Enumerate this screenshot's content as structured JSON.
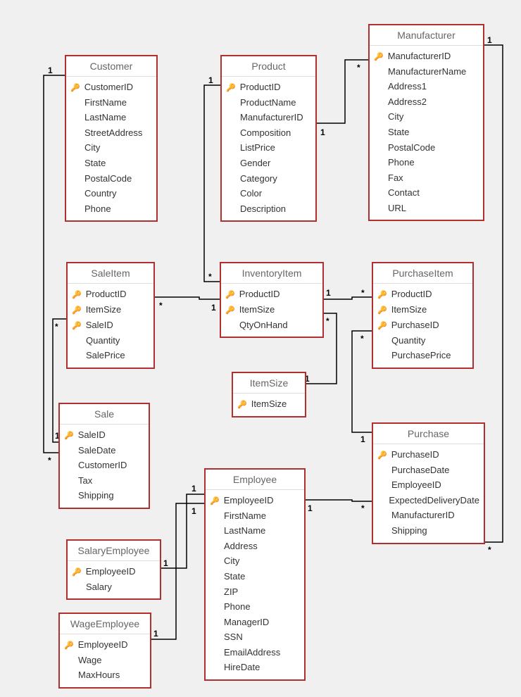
{
  "entities": {
    "customer": {
      "title": "Customer",
      "fields": [
        {
          "name": "CustomerID",
          "pk": true
        },
        {
          "name": "FirstName",
          "pk": false
        },
        {
          "name": "LastName",
          "pk": false
        },
        {
          "name": "StreetAddress",
          "pk": false
        },
        {
          "name": "City",
          "pk": false
        },
        {
          "name": "State",
          "pk": false
        },
        {
          "name": "PostalCode",
          "pk": false
        },
        {
          "name": "Country",
          "pk": false
        },
        {
          "name": "Phone",
          "pk": false
        }
      ]
    },
    "product": {
      "title": "Product",
      "fields": [
        {
          "name": "ProductID",
          "pk": true
        },
        {
          "name": "ProductName",
          "pk": false
        },
        {
          "name": "ManufacturerID",
          "pk": false
        },
        {
          "name": "Composition",
          "pk": false
        },
        {
          "name": "ListPrice",
          "pk": false
        },
        {
          "name": "Gender",
          "pk": false
        },
        {
          "name": "Category",
          "pk": false
        },
        {
          "name": "Color",
          "pk": false
        },
        {
          "name": "Description",
          "pk": false
        }
      ]
    },
    "manufacturer": {
      "title": "Manufacturer",
      "fields": [
        {
          "name": "ManufacturerID",
          "pk": true
        },
        {
          "name": "ManufacturerName",
          "pk": false
        },
        {
          "name": "Address1",
          "pk": false
        },
        {
          "name": "Address2",
          "pk": false
        },
        {
          "name": "City",
          "pk": false
        },
        {
          "name": "State",
          "pk": false
        },
        {
          "name": "PostalCode",
          "pk": false
        },
        {
          "name": "Phone",
          "pk": false
        },
        {
          "name": "Fax",
          "pk": false
        },
        {
          "name": "Contact",
          "pk": false
        },
        {
          "name": "URL",
          "pk": false
        }
      ]
    },
    "saleitem": {
      "title": "SaleItem",
      "fields": [
        {
          "name": "ProductID",
          "pk": true
        },
        {
          "name": "ItemSize",
          "pk": true
        },
        {
          "name": "SaleID",
          "pk": true
        },
        {
          "name": "Quantity",
          "pk": false
        },
        {
          "name": "SalePrice",
          "pk": false
        }
      ]
    },
    "inventoryitem": {
      "title": "InventoryItem",
      "fields": [
        {
          "name": "ProductID",
          "pk": true
        },
        {
          "name": "ItemSize",
          "pk": true
        },
        {
          "name": "QtyOnHand",
          "pk": false
        }
      ]
    },
    "purchaseitem": {
      "title": "PurchaseItem",
      "fields": [
        {
          "name": "ProductID",
          "pk": true
        },
        {
          "name": "ItemSize",
          "pk": true
        },
        {
          "name": "PurchaseID",
          "pk": true
        },
        {
          "name": "Quantity",
          "pk": false
        },
        {
          "name": "PurchasePrice",
          "pk": false
        }
      ]
    },
    "itemsize": {
      "title": "ItemSize",
      "fields": [
        {
          "name": "ItemSize",
          "pk": true
        }
      ]
    },
    "sale": {
      "title": "Sale",
      "fields": [
        {
          "name": "SaleID",
          "pk": true
        },
        {
          "name": "SaleDate",
          "pk": false
        },
        {
          "name": "CustomerID",
          "pk": false
        },
        {
          "name": "Tax",
          "pk": false
        },
        {
          "name": "Shipping",
          "pk": false
        }
      ]
    },
    "purchase": {
      "title": "Purchase",
      "fields": [
        {
          "name": "PurchaseID",
          "pk": true
        },
        {
          "name": "PurchaseDate",
          "pk": false
        },
        {
          "name": "EmployeeID",
          "pk": false
        },
        {
          "name": "ExpectedDeliveryDate",
          "pk": false
        },
        {
          "name": "ManufacturerID",
          "pk": false
        },
        {
          "name": "Shipping",
          "pk": false
        }
      ]
    },
    "employee": {
      "title": "Employee",
      "fields": [
        {
          "name": "EmployeeID",
          "pk": true
        },
        {
          "name": "FirstName",
          "pk": false
        },
        {
          "name": "LastName",
          "pk": false
        },
        {
          "name": "Address",
          "pk": false
        },
        {
          "name": "City",
          "pk": false
        },
        {
          "name": "State",
          "pk": false
        },
        {
          "name": "ZIP",
          "pk": false
        },
        {
          "name": "Phone",
          "pk": false
        },
        {
          "name": "ManagerID",
          "pk": false
        },
        {
          "name": "SSN",
          "pk": false
        },
        {
          "name": "EmailAddress",
          "pk": false
        },
        {
          "name": "HireDate",
          "pk": false
        }
      ]
    },
    "salaryemployee": {
      "title": "SalaryEmployee",
      "fields": [
        {
          "name": "EmployeeID",
          "pk": true
        },
        {
          "name": "Salary",
          "pk": false
        }
      ]
    },
    "wageemployee": {
      "title": "WageEmployee",
      "fields": [
        {
          "name": "EmployeeID",
          "pk": true
        },
        {
          "name": "Wage",
          "pk": false
        },
        {
          "name": "MaxHours",
          "pk": false
        }
      ]
    }
  },
  "relationships": [
    {
      "from": "Customer",
      "to": "Sale",
      "card_from": "1",
      "card_to": "*"
    },
    {
      "from": "Sale",
      "to": "SaleItem",
      "card_from": "1",
      "card_to": "*"
    },
    {
      "from": "InventoryItem",
      "to": "SaleItem",
      "card_from": "1",
      "card_to": "*"
    },
    {
      "from": "Product",
      "to": "InventoryItem",
      "card_from": "1",
      "card_to": "*"
    },
    {
      "from": "Product",
      "to": "Manufacturer",
      "card_from": "*",
      "card_to": "1"
    },
    {
      "from": "InventoryItem",
      "to": "PurchaseItem",
      "card_from": "1",
      "card_to": "*"
    },
    {
      "from": "Purchase",
      "to": "PurchaseItem",
      "card_from": "1",
      "card_to": "*"
    },
    {
      "from": "Manufacturer",
      "to": "Purchase",
      "card_from": "1",
      "card_to": "*"
    },
    {
      "from": "Employee",
      "to": "Purchase",
      "card_from": "1",
      "card_to": "*"
    },
    {
      "from": "Employee",
      "to": "SalaryEmployee",
      "card_from": "1",
      "card_to": "1"
    },
    {
      "from": "Employee",
      "to": "WageEmployee",
      "card_from": "1",
      "card_to": "1"
    },
    {
      "from": "ItemSize",
      "to": "InventoryItem",
      "card_from": "1",
      "card_to": "*"
    }
  ]
}
